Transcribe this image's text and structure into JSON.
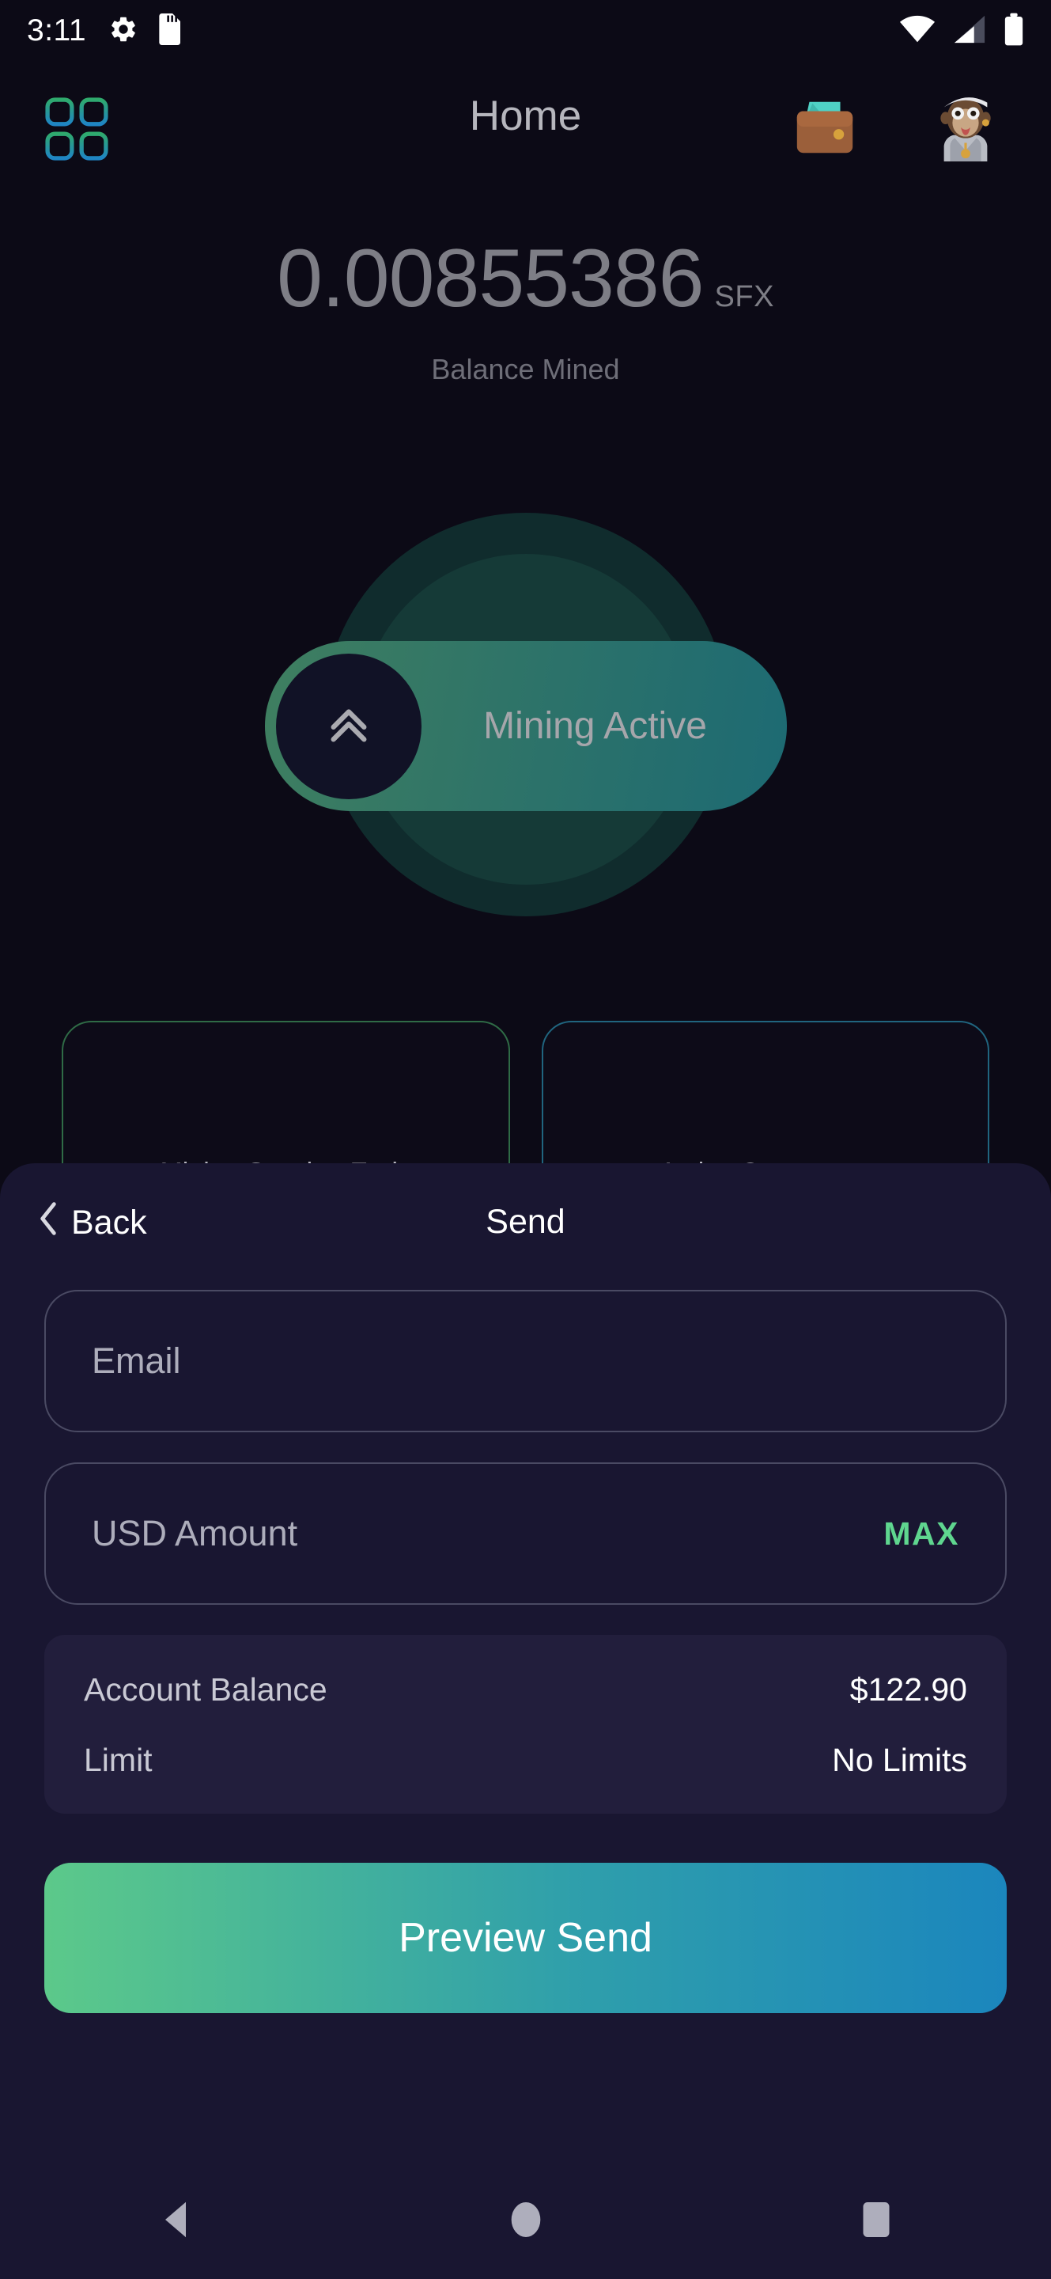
{
  "status_bar": {
    "time": "3:11",
    "left_icons": [
      "settings-gear-icon",
      "sd-card-icon"
    ],
    "right_icons": [
      "wifi-icon",
      "cellular-signal-icon",
      "battery-icon"
    ]
  },
  "header": {
    "title": "Home",
    "grid_icon": "grid-apps-icon",
    "wallet_icon": "wallet-icon",
    "avatar_icon": "profile-avatar"
  },
  "balance": {
    "value": "0.00855386",
    "unit": "SFX",
    "label": "Balance Mined"
  },
  "mining": {
    "status_label": "Mining Active",
    "knob_icon": "double-chevron-up-icon"
  },
  "stat_cards": [
    {
      "label": "Mining Session Ends",
      "accent": "#2f6b46"
    },
    {
      "label": "Active Computers",
      "accent": "#20657f"
    }
  ],
  "sheet": {
    "back_label": "Back",
    "title": "Send",
    "fields": [
      {
        "placeholder": "Email",
        "action": ""
      },
      {
        "placeholder": "USD Amount",
        "action": "MAX"
      }
    ],
    "info": [
      {
        "key": "Account Balance",
        "value": "$122.90"
      },
      {
        "key": "Limit",
        "value": "No Limits"
      }
    ],
    "cta_label": "Preview Send"
  },
  "nav_bar": {
    "back": "back-triangle-icon",
    "home": "home-circle-icon",
    "recents": "recents-square-icon"
  },
  "colors": {
    "background": "#0c0a16",
    "sheet_background": "#191631",
    "accent_green": "#5fd68f",
    "accent_blue": "#1b86bd",
    "max_green": "#5fd68f"
  }
}
